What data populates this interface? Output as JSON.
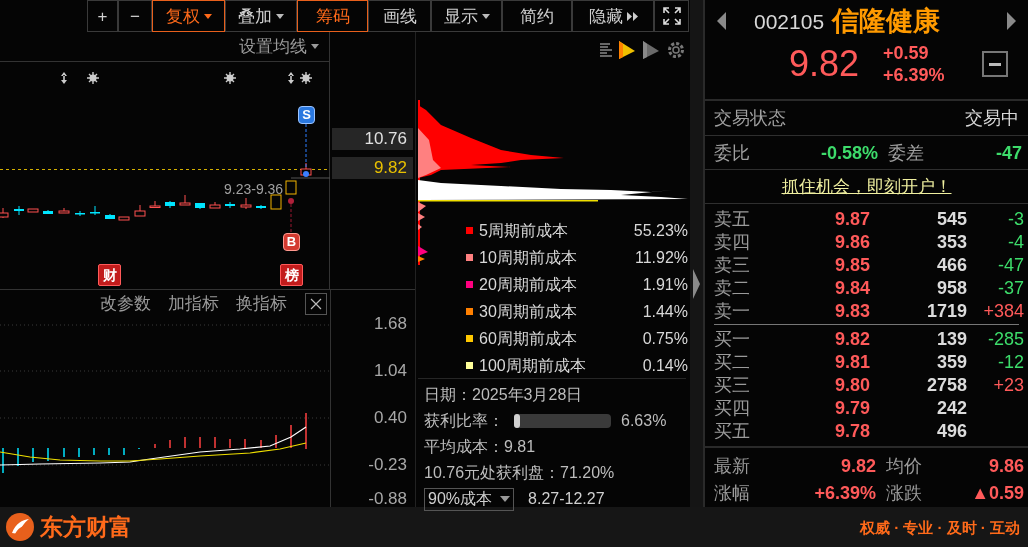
{
  "toolbar": [
    {
      "label": "+",
      "selected": false
    },
    {
      "label": "−",
      "selected": false
    },
    {
      "label": "复权",
      "selected": true,
      "dropdown": true
    },
    {
      "label": "叠加",
      "selected": false,
      "dropdown": true
    },
    {
      "label": "筹码",
      "selected": true
    },
    {
      "label": "画线",
      "selected": false
    },
    {
      "label": "显示",
      "selected": false,
      "dropdown": true
    },
    {
      "label": "简约",
      "selected": false
    },
    {
      "label": "隐藏",
      "selected": false,
      "expand_arrows": true
    }
  ],
  "main_chart": {
    "ma_setting": "设置均线",
    "range_label": "9.23-9.36",
    "price_labels": [
      {
        "text": "10.76",
        "current": false
      },
      {
        "text": "9.82",
        "current": true
      }
    ],
    "signals": [
      {
        "text": "S",
        "kind": "sell"
      },
      {
        "text": "B",
        "kind": "buy"
      }
    ],
    "event_badges": [
      "财",
      "榜"
    ]
  },
  "indicator_panel": {
    "actions": [
      "改参数",
      "加指标",
      "换指标"
    ],
    "axis_labels": [
      "1.68",
      "1.04",
      "0.40",
      "-0.23",
      "-0.88"
    ]
  },
  "chips": {
    "legend": [
      {
        "label": "5周期前成本",
        "value": "55.23%",
        "color": "#ff0000"
      },
      {
        "label": "10周期前成本",
        "value": "11.92%",
        "color": "#ff8080"
      },
      {
        "label": "20周期前成本",
        "value": "1.91%",
        "color": "#ff0080"
      },
      {
        "label": "30周期前成本",
        "value": "1.44%",
        "color": "#ff8000"
      },
      {
        "label": "60周期前成本",
        "value": "0.75%",
        "color": "#ffc800"
      },
      {
        "label": "100周期前成本",
        "value": "0.14%",
        "color": "#ffff99"
      }
    ],
    "date": "日期：2025年3月28日",
    "profit_ratio": {
      "label": "获利比率：",
      "level": 0.0663,
      "value": "6.63%"
    },
    "avg_cost": "平均成本：9.81",
    "profit_at": "10.76元处获利盘：71.20%",
    "cost_range": {
      "select": "90%成本",
      "value": "8.27-12.27"
    }
  },
  "quote": {
    "code": "002105",
    "name": "信隆健康",
    "price": "9.82",
    "change": "+0.59",
    "change_pct": "+6.39%",
    "status_label": "交易状态",
    "status": "交易中",
    "ratio_label": "委比",
    "ratio": "-0.58%",
    "ratio_up": false,
    "diff_label": "委差",
    "diff": "-47",
    "diff_up": false,
    "promo": "抓住机会，即刻开户！",
    "sells": [
      {
        "label": "卖五",
        "price": "9.87",
        "volume": "545",
        "change": "-3",
        "up": false
      },
      {
        "label": "卖四",
        "price": "9.86",
        "volume": "353",
        "change": "-4",
        "up": false
      },
      {
        "label": "卖三",
        "price": "9.85",
        "volume": "466",
        "change": "-47",
        "up": false
      },
      {
        "label": "卖二",
        "price": "9.84",
        "volume": "958",
        "change": "-37",
        "up": false
      },
      {
        "label": "卖一",
        "price": "9.83",
        "volume": "1719",
        "change": "+384",
        "up": true
      }
    ],
    "buys": [
      {
        "label": "买一",
        "price": "9.82",
        "volume": "139",
        "change": "-285",
        "up": false
      },
      {
        "label": "买二",
        "price": "9.81",
        "volume": "359",
        "change": "-12",
        "up": false
      },
      {
        "label": "买三",
        "price": "9.80",
        "volume": "2758",
        "change": "+23",
        "up": true
      },
      {
        "label": "买四",
        "price": "9.79",
        "volume": "242"
      },
      {
        "label": "买五",
        "price": "9.78",
        "volume": "496"
      }
    ],
    "stats": [
      {
        "label": "最新",
        "value": "9.82",
        "up": true
      },
      {
        "label": "均价",
        "value": "9.86",
        "up": true
      },
      {
        "label": "涨幅",
        "value": "+6.39%",
        "up": true
      },
      {
        "label": "涨跌",
        "value": "▲0.59",
        "up": true
      }
    ]
  },
  "footer": {
    "brand": "东方财富",
    "slogan": "权威 · 专业 · 及时 · 互动"
  }
}
